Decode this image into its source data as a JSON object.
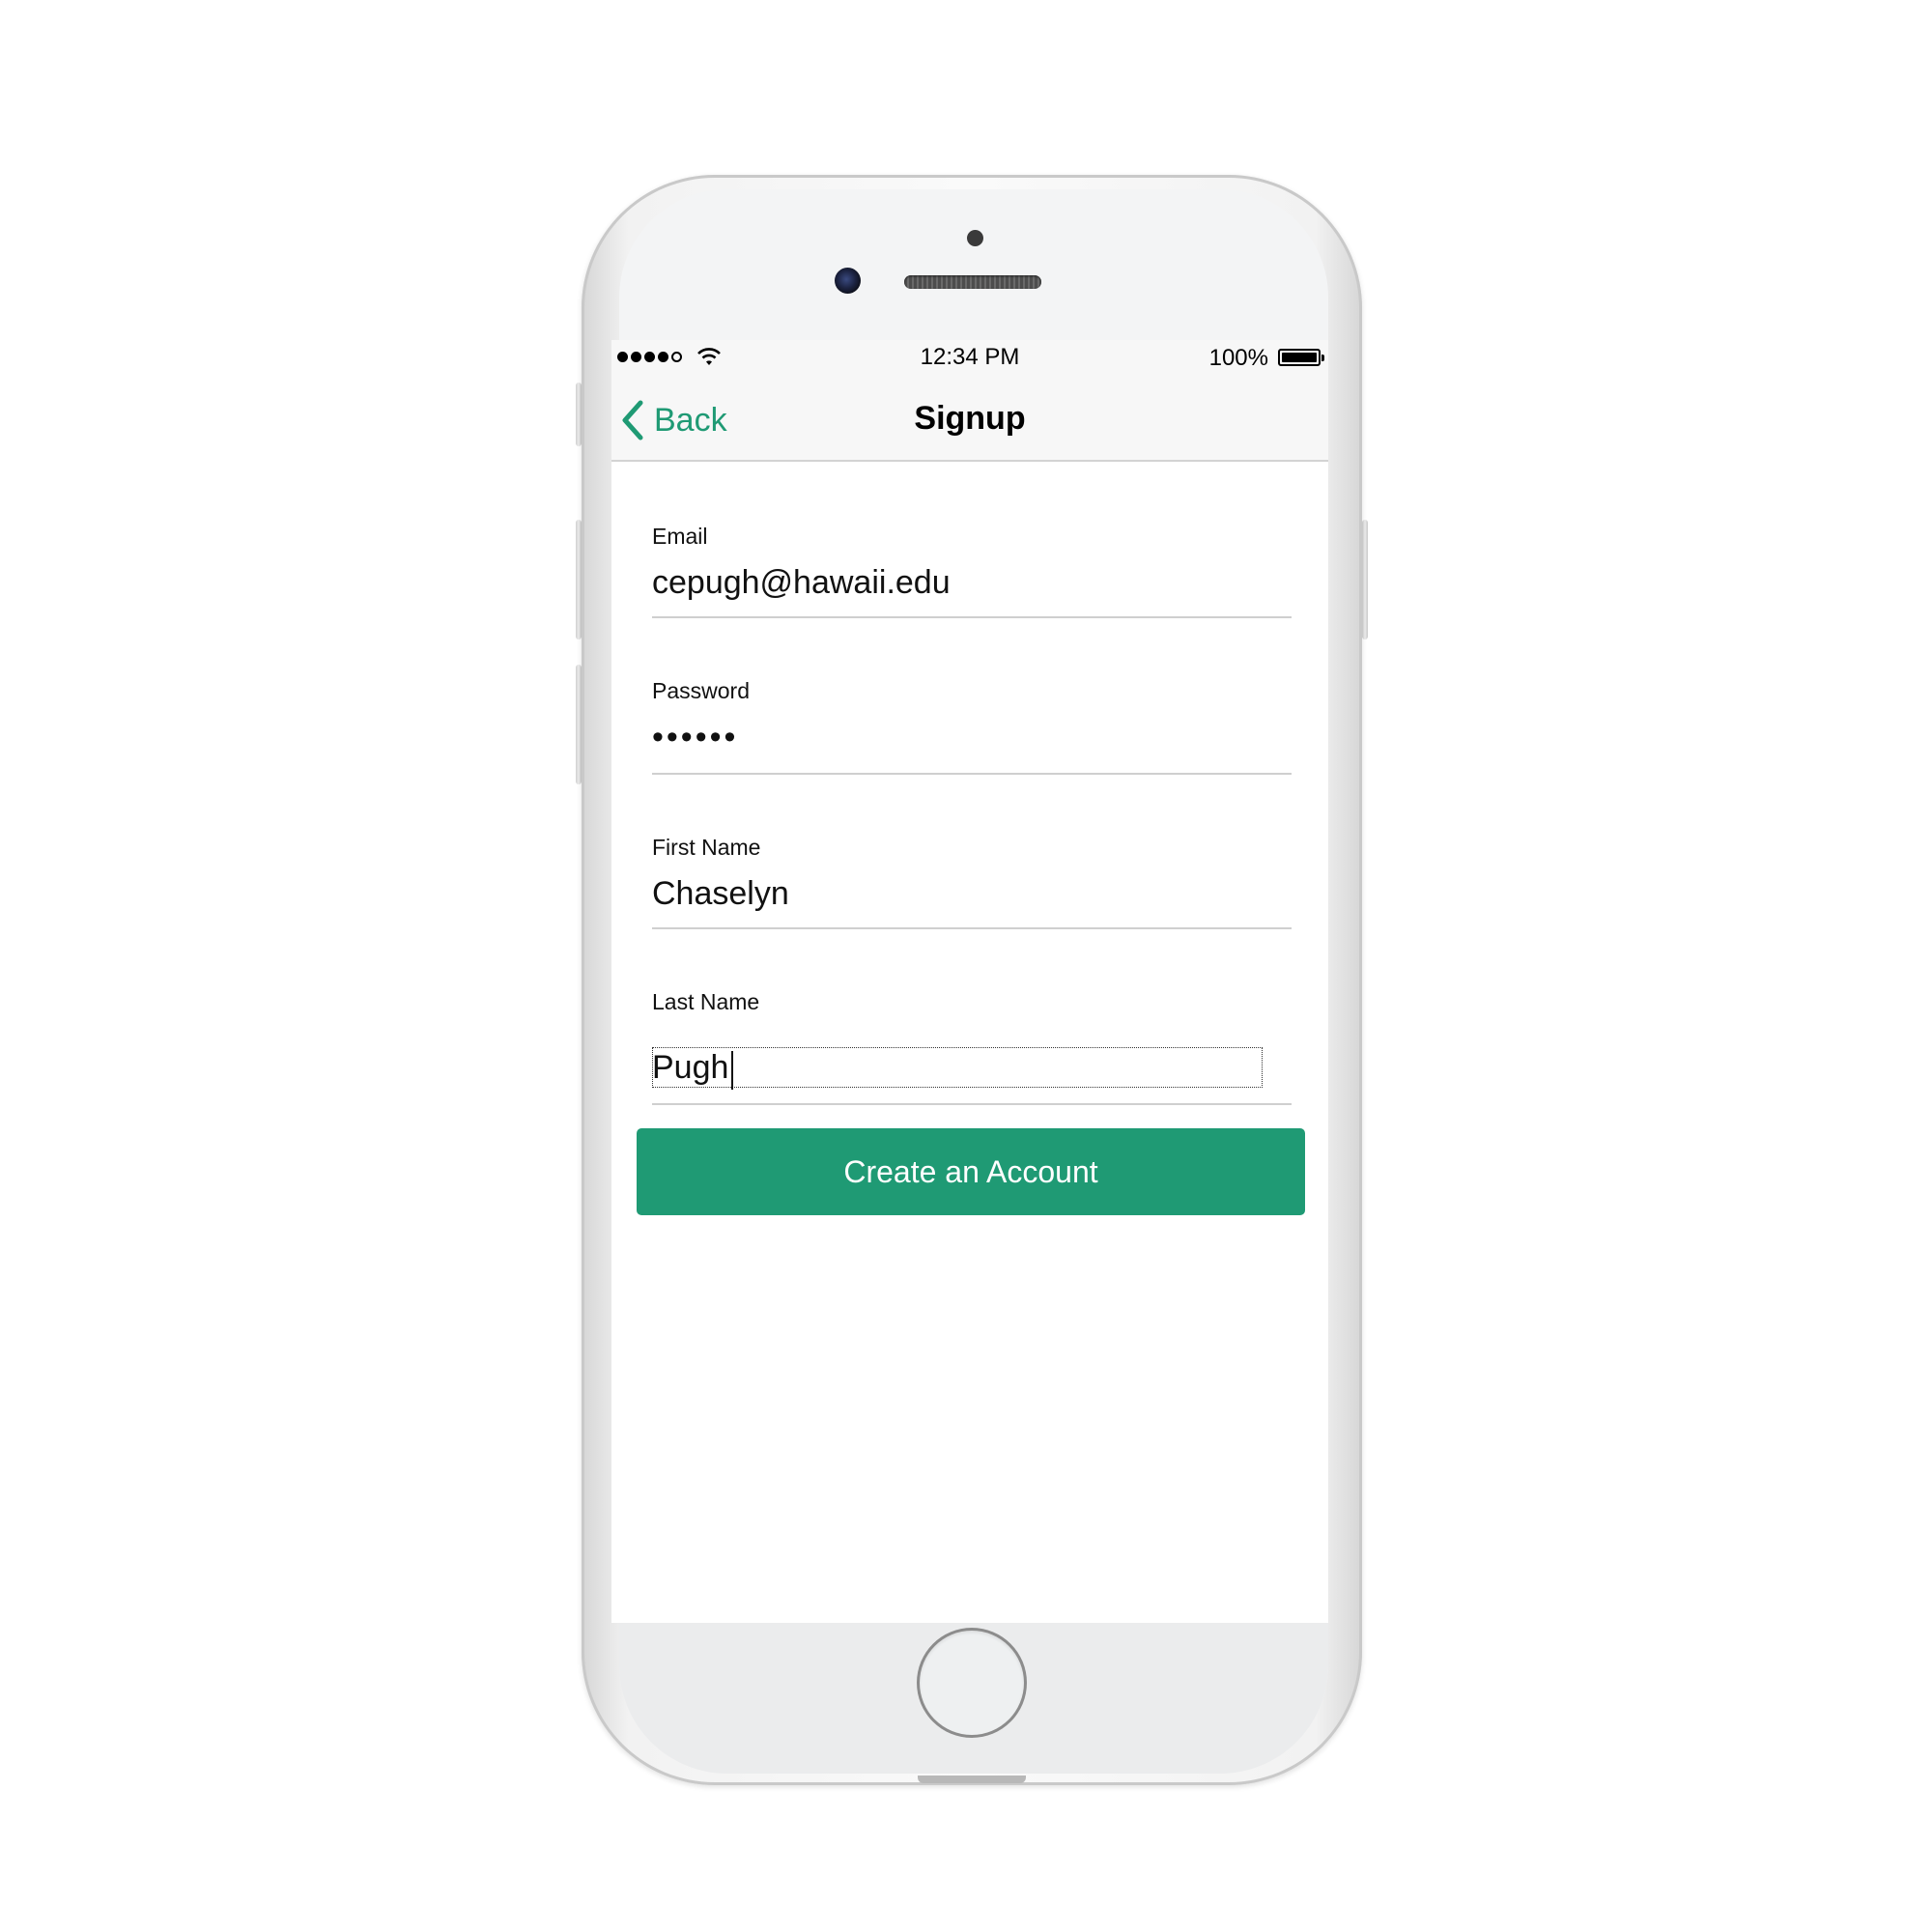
{
  "status_bar": {
    "time": "12:34 PM",
    "battery_percent": "100%",
    "signal_bars_filled": 4,
    "signal_bars_total": 5
  },
  "nav": {
    "back_label": "Back",
    "title": "Signup"
  },
  "form": {
    "email": {
      "label": "Email",
      "value": "cepugh@hawaii.edu"
    },
    "password": {
      "label": "Password",
      "value": "••••••"
    },
    "first_name": {
      "label": "First Name",
      "value": "Chaselyn"
    },
    "last_name": {
      "label": "Last Name",
      "value": "Pugh"
    }
  },
  "create_button_label": "Create an Account",
  "colors": {
    "accent": "#1f9a74",
    "navbar_bg": "#f7f7f7",
    "divider": "#cfcfcf"
  }
}
